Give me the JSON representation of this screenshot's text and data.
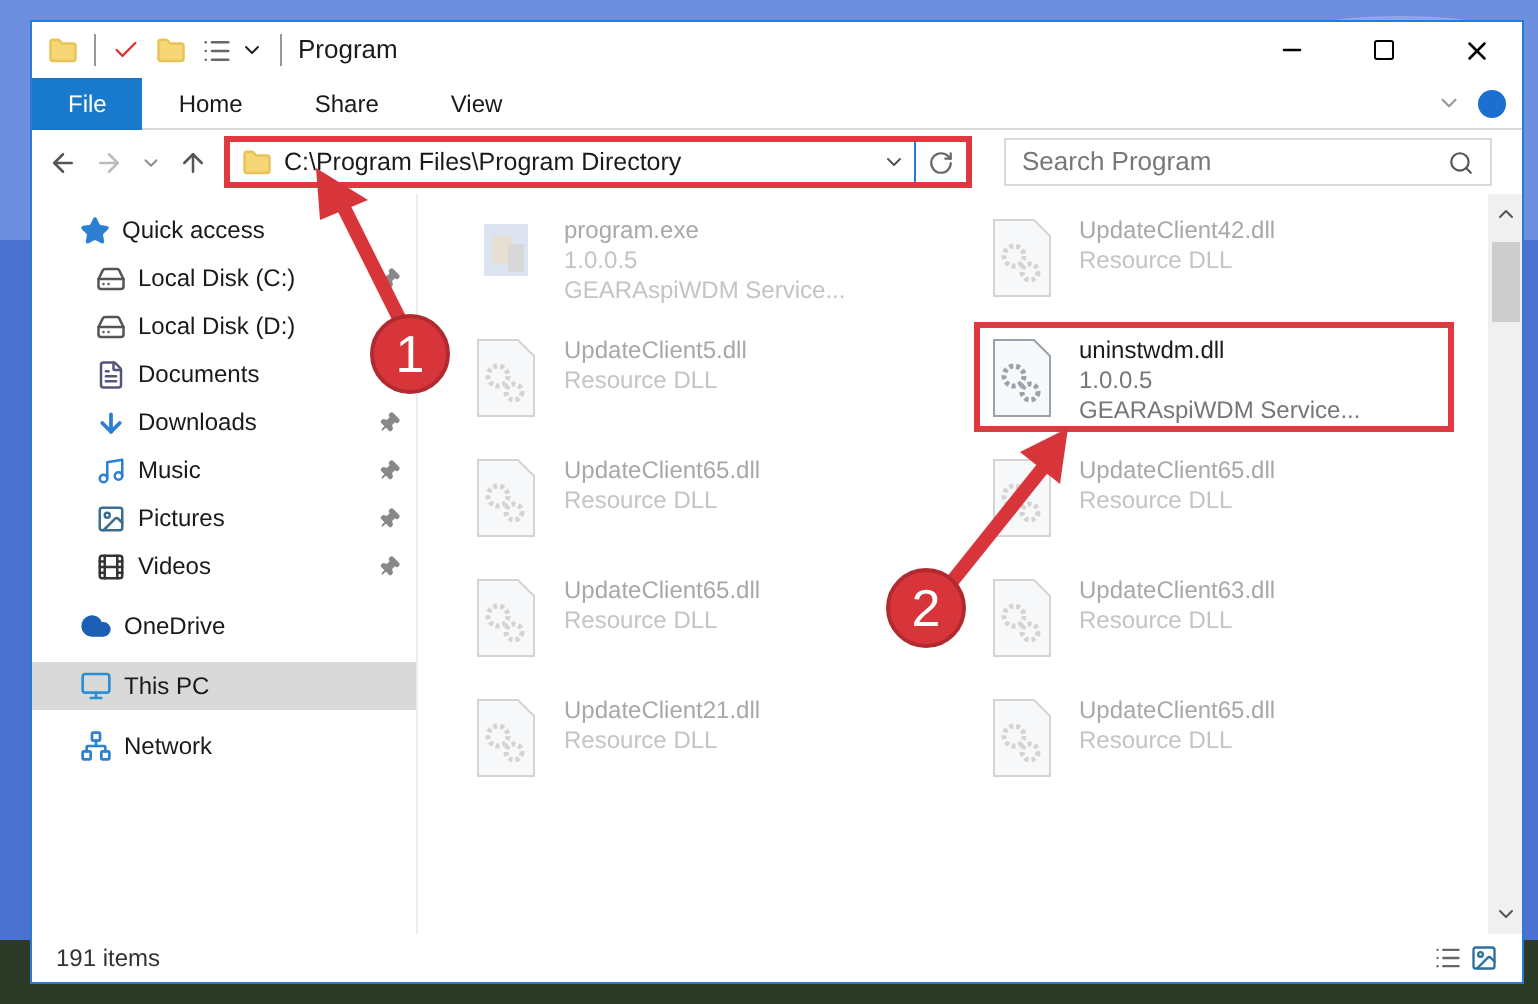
{
  "window": {
    "title": "Program"
  },
  "ribbon_tabs": [
    {
      "label": "File",
      "selected": true
    },
    {
      "label": "Home",
      "selected": false
    },
    {
      "label": "Share",
      "selected": false
    },
    {
      "label": "View",
      "selected": false
    }
  ],
  "address_bar": {
    "path": "C:\\Program Files\\Program Directory",
    "highlighted": true
  },
  "search": {
    "placeholder": "Search Program"
  },
  "sidebar": {
    "items": [
      {
        "label": "Quick access",
        "kind": "star",
        "selected": false,
        "children": [
          {
            "label": "Local Disk (C:)",
            "kind": "drive",
            "pinned": true,
            "selected": false
          },
          {
            "label": "Local Disk (D:)",
            "kind": "drive",
            "pinned": false,
            "selected": false
          },
          {
            "label": "Documents",
            "kind": "document",
            "pinned": false,
            "selected": false
          },
          {
            "label": "Downloads",
            "kind": "download",
            "pinned": true,
            "selected": false
          },
          {
            "label": "Music",
            "kind": "music",
            "pinned": true,
            "selected": false
          },
          {
            "label": "Pictures",
            "kind": "picture",
            "pinned": true,
            "selected": false
          },
          {
            "label": "Videos",
            "kind": "video",
            "pinned": true,
            "selected": false
          }
        ]
      },
      {
        "label": "OneDrive",
        "kind": "cloud",
        "selected": false
      },
      {
        "label": "This PC",
        "kind": "pc",
        "selected": true
      },
      {
        "label": "Network",
        "kind": "network",
        "selected": false
      }
    ]
  },
  "files": [
    {
      "kind": "exe",
      "name": "program.exe",
      "lines": [
        "1.0.0.5",
        "GEARAspiWDM Service..."
      ],
      "highlighted": false
    },
    {
      "kind": "dll",
      "name": "UpdateClient42.dll",
      "lines": [
        "Resource DLL"
      ],
      "highlighted": false
    },
    {
      "kind": "dll",
      "name": "UpdateClient5.dll",
      "lines": [
        "Resource DLL"
      ],
      "highlighted": false
    },
    {
      "kind": "dll",
      "name": "uninstwdm.dll",
      "lines": [
        "1.0.0.5",
        "GEARAspiWDM Service..."
      ],
      "highlighted": true
    },
    {
      "kind": "dll",
      "name": "UpdateClient65.dll",
      "lines": [
        "Resource DLL"
      ],
      "highlighted": false
    },
    {
      "kind": "dll",
      "name": "UpdateClient65.dll",
      "lines": [
        "Resource DLL"
      ],
      "highlighted": false
    },
    {
      "kind": "dll",
      "name": "UpdateClient65.dll",
      "lines": [
        "Resource DLL"
      ],
      "highlighted": false
    },
    {
      "kind": "dll",
      "name": "UpdateClient63.dll",
      "lines": [
        "Resource DLL"
      ],
      "highlighted": false
    },
    {
      "kind": "dll",
      "name": "UpdateClient21.dll",
      "lines": [
        "Resource DLL"
      ],
      "highlighted": false
    },
    {
      "kind": "dll",
      "name": "UpdateClient65.dll",
      "lines": [
        "Resource DLL"
      ],
      "highlighted": false
    }
  ],
  "status_bar": {
    "item_count": "191 items"
  },
  "callouts": [
    {
      "label": "1"
    },
    {
      "label": "2"
    }
  ]
}
